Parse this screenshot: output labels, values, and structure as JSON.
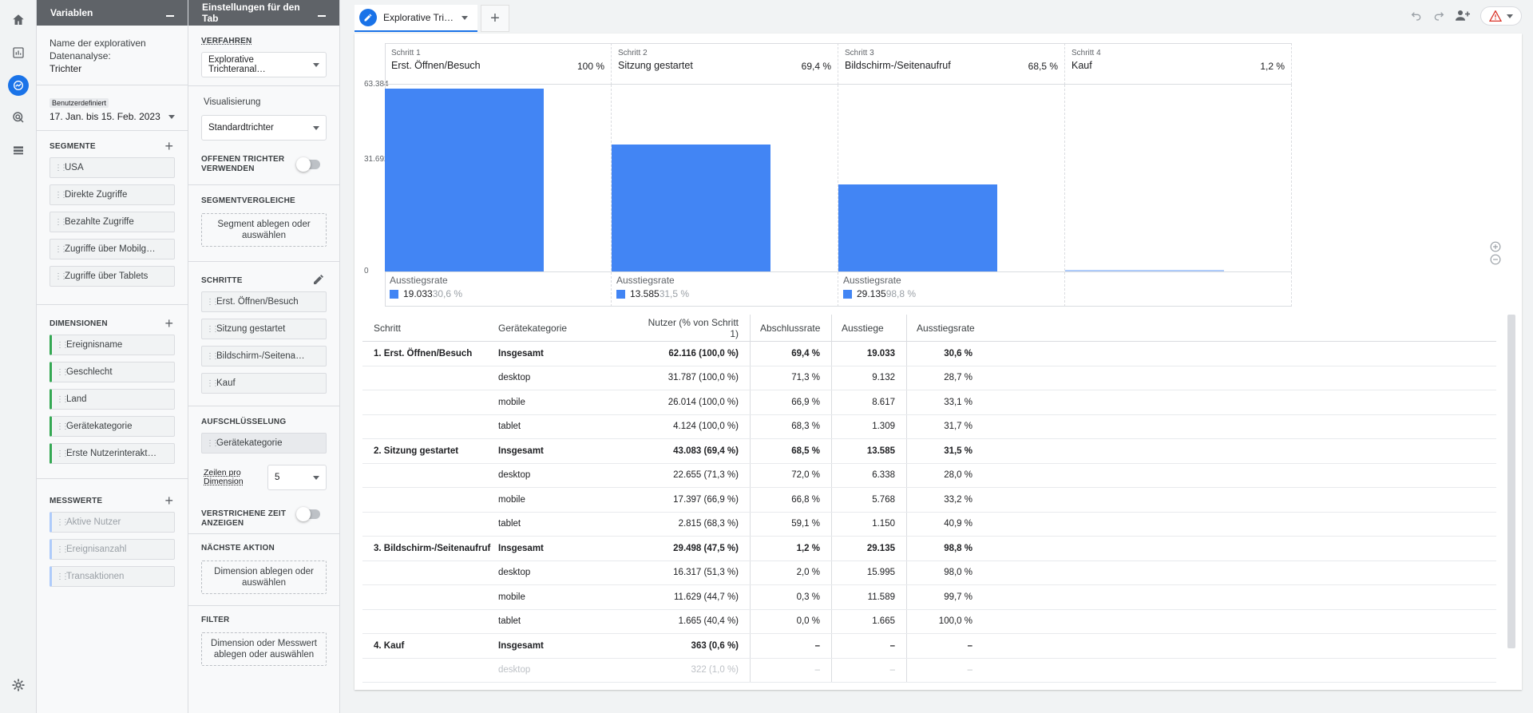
{
  "rail": {
    "icons": [
      "home-icon",
      "reports-icon",
      "explore-icon",
      "advertising-icon",
      "list-icon",
      "settings-icon"
    ]
  },
  "variables": {
    "header": "Variablen",
    "name_label": "Name der explorativen Datenanalyse:",
    "name_value": "Trichter",
    "date_badge": "Benutzerdefiniert",
    "date_range": "17. Jan. bis 15. Feb. 2023",
    "segments_title": "SEGMENTE",
    "segments": [
      "USA",
      "Direkte Zugriffe",
      "Bezahlte Zugriffe",
      "Zugriffe über Mobilg…",
      "Zugriffe über Tablets"
    ],
    "dimensions_title": "DIMENSIONEN",
    "dimensions": [
      "Ereignisname",
      "Geschlecht",
      "Land",
      "Gerätekategorie",
      "Erste Nutzerinterakt…"
    ],
    "metrics_title": "MESSWERTE",
    "metrics": [
      "Aktive Nutzer",
      "Ereignisanzahl",
      "Transaktionen"
    ]
  },
  "settings": {
    "header": "Einstellungen für den Tab",
    "technique_title": "VERFAHREN",
    "technique_value": "Explorative Trichteranal…",
    "visualization_title": "Visualisierung",
    "visualization_value": "Standardtrichter",
    "open_funnel_label": "OFFENEN TRICHTER VERWENDEN",
    "segment_comparisons_title": "SEGMENTVERGLEICHE",
    "segment_drop": "Segment ablegen oder auswählen",
    "steps_title": "SCHRITTE",
    "steps": [
      "Erst. Öffnen/Besuch",
      "Sitzung gestartet",
      "Bildschirm-/Seitena…",
      "Kauf"
    ],
    "breakdown_title": "AUFSCHLÜSSELUNG",
    "breakdown_value": "Gerätekategorie",
    "rows_label": "Zeilen pro Dimension",
    "rows_value": "5",
    "elapsed_label": "VERSTRICHENE ZEIT ANZEIGEN",
    "next_action_title": "NÄCHSTE AKTION",
    "next_action_drop": "Dimension ablegen oder auswählen",
    "filter_title": "FILTER",
    "filter_drop": "Dimension oder Messwert ablegen oder auswählen"
  },
  "tabs": {
    "active_label": "Explorative Tri…",
    "add_label": "+"
  },
  "chart_data": {
    "type": "bar",
    "yticks": [
      "63.384",
      "31.692",
      "0"
    ],
    "ylim": [
      0,
      63384
    ],
    "steps": [
      {
        "no": "Schritt 1",
        "name": "Erst. Öffnen/Besuch",
        "pct": "100 %",
        "value": 62116,
        "drop_label": "Ausstiegsrate",
        "drop_value": "19.033",
        "drop_pct": "30,6 %"
      },
      {
        "no": "Schritt 2",
        "name": "Sitzung gestartet",
        "pct": "69,4 %",
        "value": 43083,
        "drop_label": "Ausstiegsrate",
        "drop_value": "13.585",
        "drop_pct": "31,5 %"
      },
      {
        "no": "Schritt 3",
        "name": "Bildschirm-/Seitenaufruf",
        "pct": "68,5 %",
        "value": 29498,
        "drop_label": "Ausstiegsrate",
        "drop_value": "29.135",
        "drop_pct": "98,8 %"
      },
      {
        "no": "Schritt 4",
        "name": "Kauf",
        "pct": "1,2 %",
        "value": 363
      }
    ],
    "colors": {
      "bar": "#4285f4"
    }
  },
  "table": {
    "headers": [
      "Schritt",
      "Gerätekategorie",
      "Nutzer (% von Schritt 1)",
      "Abschlussrate",
      "Ausstiege",
      "Ausstiegsrate"
    ],
    "rows": [
      [
        "1. Erst. Öffnen/Besuch",
        "Insgesamt",
        "62.116 (100,0 %)",
        "69,4 %",
        "19.033",
        "30,6 %"
      ],
      [
        "",
        "desktop",
        "31.787 (100,0 %)",
        "71,3 %",
        "9.132",
        "28,7 %"
      ],
      [
        "",
        "mobile",
        "26.014 (100,0 %)",
        "66,9 %",
        "8.617",
        "33,1 %"
      ],
      [
        "",
        "tablet",
        "4.124 (100,0 %)",
        "68,3 %",
        "1.309",
        "31,7 %"
      ],
      [
        "2. Sitzung gestartet",
        "Insgesamt",
        "43.083 (69,4 %)",
        "68,5 %",
        "13.585",
        "31,5 %"
      ],
      [
        "",
        "desktop",
        "22.655 (71,3 %)",
        "72,0 %",
        "6.338",
        "28,0 %"
      ],
      [
        "",
        "mobile",
        "17.397 (66,9 %)",
        "66,8 %",
        "5.768",
        "33,2 %"
      ],
      [
        "",
        "tablet",
        "2.815 (68,3 %)",
        "59,1 %",
        "1.150",
        "40,9 %"
      ],
      [
        "3. Bildschirm-/Seitenaufruf",
        "Insgesamt",
        "29.498 (47,5 %)",
        "1,2 %",
        "29.135",
        "98,8 %"
      ],
      [
        "",
        "desktop",
        "16.317 (51,3 %)",
        "2,0 %",
        "15.995",
        "98,0 %"
      ],
      [
        "",
        "mobile",
        "11.629 (44,7 %)",
        "0,3 %",
        "11.589",
        "99,7 %"
      ],
      [
        "",
        "tablet",
        "1.665 (40,4 %)",
        "0,0 %",
        "1.665",
        "100,0 %"
      ],
      [
        "4. Kauf",
        "Insgesamt",
        "363 (0,6 %)",
        "–",
        "–",
        "–"
      ],
      [
        "",
        "desktop",
        "322 (1,0 %)",
        "–",
        "–",
        "–"
      ]
    ]
  }
}
